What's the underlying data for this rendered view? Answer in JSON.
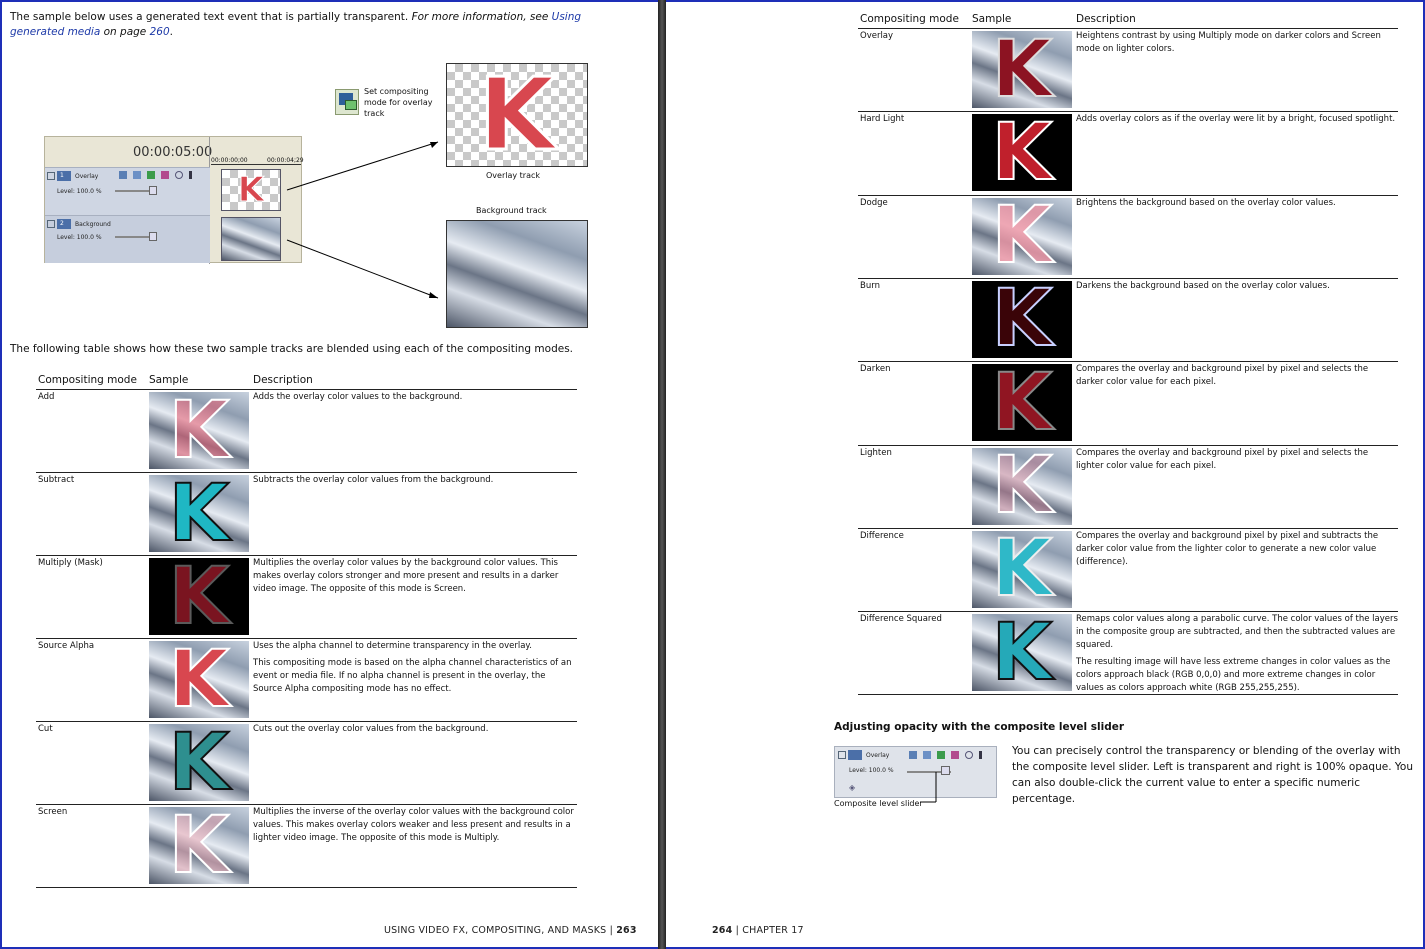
{
  "left": {
    "intro": "The sample below uses a generated text event that is partially transparent. ",
    "intro_italic": "For more information, see ",
    "intro_link": "Using generated media",
    "intro_tail": " on page ",
    "intro_page": "260",
    "intro_end": ".",
    "callout": "Set compositing mode for overlay track",
    "timecode": "00:00:05:00",
    "ruler_start": "00:00:00;00",
    "ruler_end": "00:00:04;29",
    "track1_num": "1",
    "track1_name": "Overlay",
    "track1_level": "Level: 100.0 %",
    "track2_num": "2",
    "track2_name": "Background",
    "track2_level": "Level: 100.0 %",
    "overlay_caption": "Overlay track",
    "background_caption": "Background track",
    "table_intro": "The following table shows how these two sample tracks are blended using each of the compositing modes.",
    "col_mode": "Compositing mode",
    "col_sample": "Sample",
    "col_desc": "Description",
    "rows": [
      {
        "mode": "Add",
        "desc": [
          "Adds the overlay color values to the background."
        ],
        "style": "add"
      },
      {
        "mode": "Subtract",
        "desc": [
          "Subtracts the overlay color values from the background."
        ],
        "style": "subtract"
      },
      {
        "mode": "Multiply (Mask)",
        "desc": [
          "Multiplies the overlay color values by the background color values. This makes overlay colors stronger and more present and results in a darker video image. The opposite of this mode is Screen."
        ],
        "style": "multiply"
      },
      {
        "mode": "Source Alpha",
        "desc": [
          "Uses the alpha channel to determine transparency in the overlay.",
          "This compositing mode is based on the alpha channel characteristics of an event or media file. If no alpha channel is present in the overlay, the Source Alpha compositing mode has no effect."
        ],
        "style": "alpha"
      },
      {
        "mode": "Cut",
        "desc": [
          "Cuts out the overlay color values from the background."
        ],
        "style": "cut"
      },
      {
        "mode": "Screen",
        "desc": [
          "Multiplies the inverse of the overlay color values with the background color values. This makes overlay colors weaker and less present and results in a lighter video image. The opposite of this mode is Multiply."
        ],
        "style": "screen"
      }
    ],
    "footer_text": "USING VIDEO FX, COMPOSITING, AND MASKS | ",
    "footer_page": "263"
  },
  "right": {
    "col_mode": "Compositing mode",
    "col_sample": "Sample",
    "col_desc": "Description",
    "rows": [
      {
        "mode": "Overlay",
        "desc": [
          "Heightens contrast by using Multiply mode on darker colors and Screen mode on lighter colors."
        ],
        "style": "overlay"
      },
      {
        "mode": "Hard Light",
        "desc": [
          "Adds overlay colors as if the overlay were lit by a bright, focused spotlight."
        ],
        "style": "hardlight"
      },
      {
        "mode": "Dodge",
        "desc": [
          "Brightens the background based on the overlay color values."
        ],
        "style": "dodge"
      },
      {
        "mode": "Burn",
        "desc": [
          "Darkens the background based on the overlay color values."
        ],
        "style": "burn"
      },
      {
        "mode": "Darken",
        "desc": [
          "Compares the overlay and background pixel by pixel and selects the darker color value for each pixel."
        ],
        "style": "darken"
      },
      {
        "mode": "Lighten",
        "desc": [
          "Compares the overlay and background pixel by pixel and selects the lighter color value for each pixel."
        ],
        "style": "lighten"
      },
      {
        "mode": "Difference",
        "desc": [
          "Compares the overlay and background pixel by pixel and subtracts the darker color value from the lighter color to generate a new color value (difference)."
        ],
        "style": "difference"
      },
      {
        "mode": "Difference Squared",
        "desc": [
          "Remaps color values along a parabolic curve. The color values of the layers in the composite group are subtracted, and then the subtracted values are squared.",
          "The resulting image will have less extreme changes in color values as the colors approach black (RGB 0,0,0) and more extreme changes in color values as colors approach white (RGB 255,255,255)."
        ],
        "style": "diffsq"
      }
    ],
    "heading": "Adjusting opacity with the composite level slider",
    "slider_track_name": "Overlay",
    "slider_level": "Level: 100.0 %",
    "slider_caption": "Composite level slider",
    "paragraph": "You can precisely control the transparency or blending of the overlay with the composite level slider. Left is transparent and right is 100% opaque. You can also double-click the current value to enter a specific numeric percentage.",
    "footer_page": "264",
    "footer_text": " | CHAPTER 17"
  },
  "colors": {
    "frame": "#1e2fb8",
    "link": "#1e3aa8",
    "k_red": "#d8474f",
    "k_teal": "#2ec4c8"
  }
}
